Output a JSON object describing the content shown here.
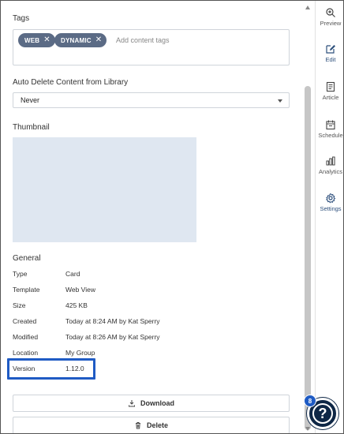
{
  "tags": {
    "label": "Tags",
    "chips": [
      {
        "text": "WEB",
        "remove": "✕"
      },
      {
        "text": "DYNAMIC",
        "remove": "✕"
      }
    ],
    "placeholder": "Add content tags"
  },
  "auto_delete": {
    "label": "Auto Delete Content from Library",
    "selected": "Never"
  },
  "thumbnail": {
    "label": "Thumbnail"
  },
  "general": {
    "heading": "General",
    "rows": [
      {
        "key": "Type",
        "value": "Card"
      },
      {
        "key": "Template",
        "value": "Web View"
      },
      {
        "key": "Size",
        "value": "425 KB"
      },
      {
        "key": "Created",
        "value": "Today at 8:24 AM by Kat Sperry"
      },
      {
        "key": "Modified",
        "value": "Today at 8:26 AM by Kat Sperry"
      },
      {
        "key": "Location",
        "value": "My Group"
      },
      {
        "key": "Version",
        "value": "1.12.0"
      }
    ]
  },
  "actions": {
    "download": "Download",
    "delete": "Delete"
  },
  "sidenav": {
    "items": [
      {
        "label": "Preview",
        "icon": "zoom-icon"
      },
      {
        "label": "Edit",
        "icon": "pencil-icon"
      },
      {
        "label": "Article",
        "icon": "article-icon"
      },
      {
        "label": "Schedule",
        "icon": "calendar-icon"
      },
      {
        "label": "Analytics",
        "icon": "bar-chart-icon"
      },
      {
        "label": "Settings",
        "icon": "gear-icon"
      }
    ],
    "active": "Settings"
  },
  "help": {
    "badge_count": "8",
    "glyph": "?"
  },
  "colors": {
    "chip_bg": "#5b6b85",
    "highlight": "#1f5bc4",
    "thumbnail_bg": "#dfe7f1",
    "help_bg": "#0e2746",
    "active_nav": "#2d4f7c"
  }
}
